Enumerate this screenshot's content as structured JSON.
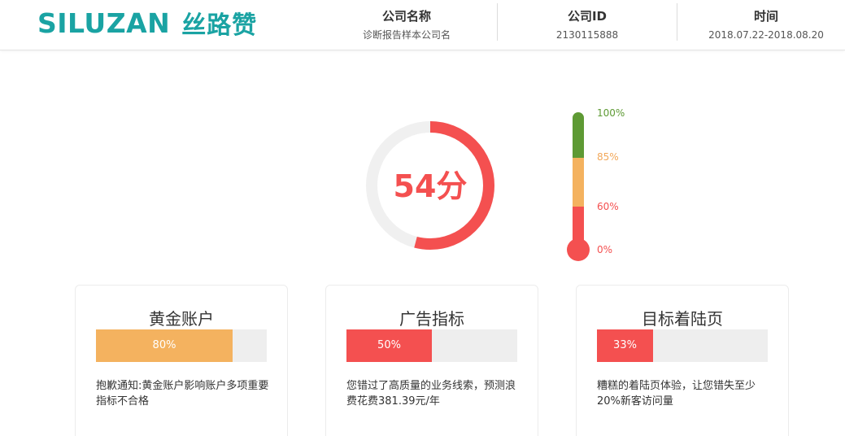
{
  "header": {
    "logo_en": "SILUZAN",
    "logo_cn": "丝路赞",
    "company_name_label": "公司名称",
    "company_name_value": "诊断报告样本公司名",
    "company_id_label": "公司ID",
    "company_id_value": "2130115888",
    "time_label": "时间",
    "time_value": "2018.07.22-2018.08.20"
  },
  "score": {
    "value": 54,
    "text": "54分",
    "color": "#f45050"
  },
  "thermometer": {
    "labels": [
      {
        "text": "100%",
        "color": "#5e9a34"
      },
      {
        "text": "85%",
        "color": "#f2a85a"
      },
      {
        "text": "60%",
        "color": "#f45050"
      },
      {
        "text": "0%",
        "color": "#f45050"
      }
    ],
    "colors": {
      "green": "#5e9a34",
      "orange": "#f4b25f",
      "red": "#f45050"
    }
  },
  "cards": [
    {
      "title": "黄金账户",
      "percent": 80,
      "percent_text": "80%",
      "color": "#f4b25f",
      "desc": "抱歉通知:黄金账户影响账户多项重要指标不合格"
    },
    {
      "title": "广告指标",
      "percent": 50,
      "percent_text": "50%",
      "color": "#f45050",
      "desc": "您错过了高质量的业务线索，预测浪费花费381.39元/年"
    },
    {
      "title": "目标着陆页",
      "percent": 33,
      "percent_text": "33%",
      "color": "#f45050",
      "desc": "糟糕的着陆页体验，让您错失至少20%新客访问量"
    }
  ]
}
